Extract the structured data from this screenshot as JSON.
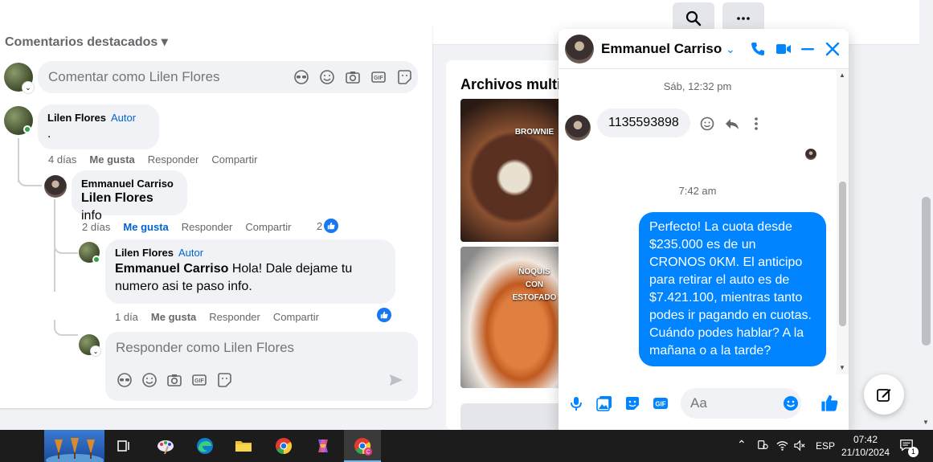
{
  "topbar": {
    "search_icon": "search-icon",
    "more_icon": "more-horizontal-icon"
  },
  "comments": {
    "section_title": "Comentarios destacados",
    "composer_placeholder": "Comentar como Lilen Flores",
    "items": [
      {
        "name": "Lilen Flores",
        "badge": "Autor",
        "text": ".",
        "time": "4 días",
        "like": "Me gusta",
        "reply": "Responder",
        "share": "Compartir"
      },
      {
        "name": "Emmanuel Carriso",
        "mention": "Lilen Flores",
        "text": " info",
        "time": "2 días",
        "like": "Me gusta",
        "reply": "Responder",
        "share": "Compartir",
        "reactions": "2"
      },
      {
        "name": "Lilen Flores",
        "badge": "Autor",
        "mention": "Emmanuel Carriso",
        "text": " Hola! Dale dejame tu numero asi te paso info.",
        "time": "1 día",
        "like": "Me gusta",
        "reply": "Responder",
        "share": "Compartir"
      }
    ],
    "reply_placeholder": "Responder como Lilen Flores"
  },
  "files": {
    "title": "Archivos multimedia",
    "photo1_label": "BROWNIE",
    "photo2_label": "ÑOQUIS CON ESTOFADO"
  },
  "chat": {
    "contact_name": "Emmanuel Carriso",
    "timestamp1": "Sáb, 12:32 pm",
    "incoming_message": "1135593898",
    "timestamp2": "7:42 am",
    "outgoing_message": "Perfecto! La cuota desde $235.000 es de un CRONOS 0KM. El anticipo para retirar el auto es de $7.421.100, mientras tanto podes ir pagando en cuotas. Cuándo podes hablar? A la mañana o a la tarde?",
    "input_placeholder": "Aa",
    "accent_color": "#0084ff"
  },
  "taskbar": {
    "language": "ESP",
    "time": "07:42",
    "date": "21/10/2024",
    "notifications": "1"
  }
}
